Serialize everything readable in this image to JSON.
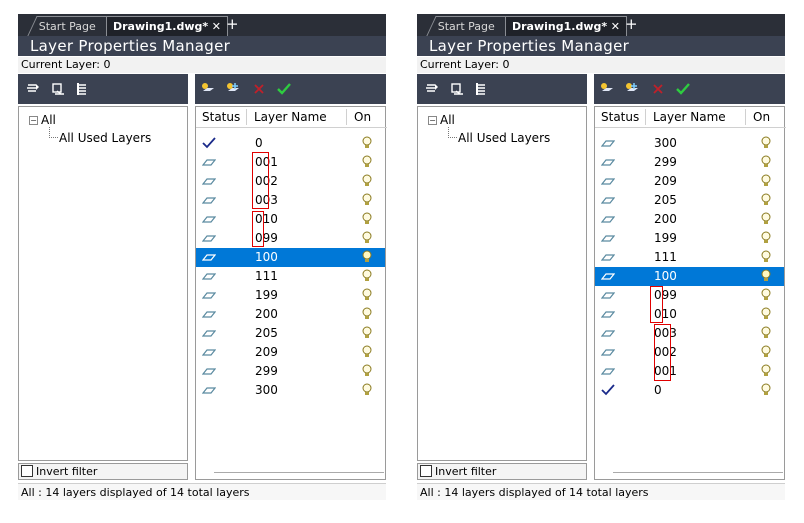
{
  "panels": [
    {
      "tabs": {
        "start": "Start Page",
        "active": "Drawing1.dwg*",
        "close": "✕",
        "add": "+"
      },
      "title": "Layer Properties Manager",
      "current_layer": "Current Layer: 0",
      "tree": {
        "all": "All",
        "used": "All Used Layers",
        "expander": "−"
      },
      "columns": {
        "status": "Status",
        "name": "Layer Name",
        "on": "On"
      },
      "rows": [
        {
          "name": "0",
          "status": "current-check",
          "selected": false
        },
        {
          "name": "001",
          "status": "layer-parallelogram",
          "selected": false
        },
        {
          "name": "002",
          "status": "layer-parallelogram",
          "selected": false
        },
        {
          "name": "003",
          "status": "layer-parallelogram",
          "selected": false
        },
        {
          "name": "010",
          "status": "layer-parallelogram",
          "selected": false
        },
        {
          "name": "099",
          "status": "layer-parallelogram",
          "selected": false
        },
        {
          "name": "100",
          "status": "layer-parallelogram",
          "selected": true
        },
        {
          "name": "111",
          "status": "layer-parallelogram",
          "selected": false
        },
        {
          "name": "199",
          "status": "layer-parallelogram",
          "selected": false
        },
        {
          "name": "200",
          "status": "layer-parallelogram",
          "selected": false
        },
        {
          "name": "205",
          "status": "layer-parallelogram",
          "selected": false
        },
        {
          "name": "209",
          "status": "layer-parallelogram",
          "selected": false
        },
        {
          "name": "299",
          "status": "layer-parallelogram",
          "selected": false
        },
        {
          "name": "300",
          "status": "layer-parallelogram",
          "selected": false
        }
      ],
      "invert_filter": "Invert filter",
      "status_text": "All : 14 layers displayed of 14 total layers"
    },
    {
      "tabs": {
        "start": "Start Page",
        "active": "Drawing1.dwg*",
        "close": "✕",
        "add": "+"
      },
      "title": "Layer Properties Manager",
      "current_layer": "Current Layer: 0",
      "tree": {
        "all": "All",
        "used": "All Used Layers",
        "expander": "−"
      },
      "columns": {
        "status": "Status",
        "name": "Layer Name",
        "on": "On"
      },
      "rows": [
        {
          "name": "300",
          "status": "layer-parallelogram",
          "selected": false
        },
        {
          "name": "299",
          "status": "layer-parallelogram",
          "selected": false
        },
        {
          "name": "209",
          "status": "layer-parallelogram",
          "selected": false
        },
        {
          "name": "205",
          "status": "layer-parallelogram",
          "selected": false
        },
        {
          "name": "200",
          "status": "layer-parallelogram",
          "selected": false
        },
        {
          "name": "199",
          "status": "layer-parallelogram",
          "selected": false
        },
        {
          "name": "111",
          "status": "layer-parallelogram",
          "selected": false
        },
        {
          "name": "100",
          "status": "layer-parallelogram",
          "selected": true
        },
        {
          "name": "099",
          "status": "layer-parallelogram",
          "selected": false
        },
        {
          "name": "010",
          "status": "layer-parallelogram",
          "selected": false
        },
        {
          "name": "003",
          "status": "layer-parallelogram",
          "selected": false
        },
        {
          "name": "002",
          "status": "layer-parallelogram",
          "selected": false
        },
        {
          "name": "001",
          "status": "layer-parallelogram",
          "selected": false
        },
        {
          "name": "0",
          "status": "current-check",
          "selected": false
        }
      ],
      "invert_filter": "Invert filter",
      "status_text": "All : 14 layers displayed of 14 total layers"
    }
  ],
  "colors": {
    "selected_row": "#0078d7",
    "annotation_box": "#e00000",
    "header_bar": "#3b4252",
    "check": "#1a2a8a"
  }
}
